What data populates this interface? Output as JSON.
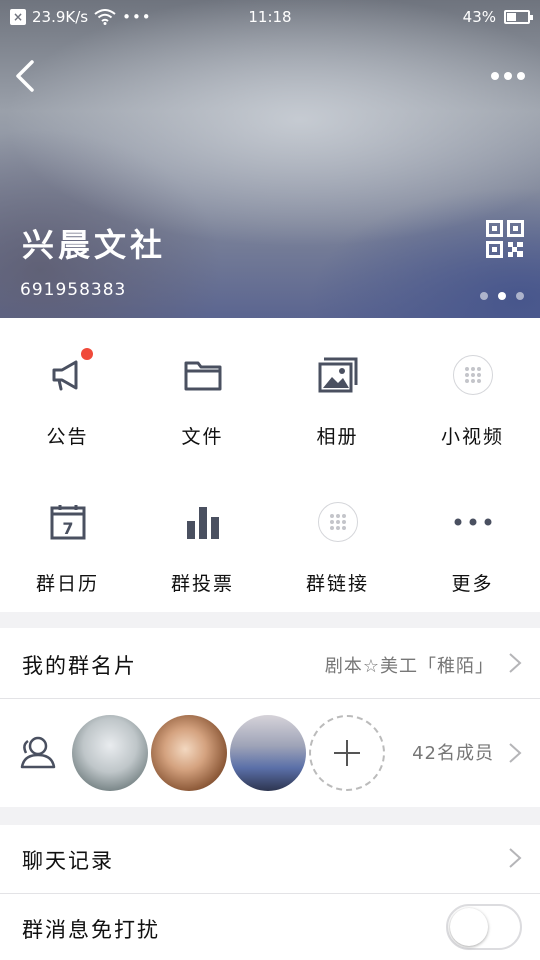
{
  "status_bar": {
    "net_speed": "23.9K/s",
    "time": "11:18",
    "battery": "43%",
    "battery_level": 0.43
  },
  "header": {
    "group_name": "兴晨文社",
    "group_id": "691958383",
    "page_count": 3,
    "active_page": 1
  },
  "grid": {
    "items": [
      {
        "label": "公告",
        "icon": "megaphone-icon"
      },
      {
        "label": "文件",
        "icon": "folder-icon"
      },
      {
        "label": "相册",
        "icon": "album-icon"
      },
      {
        "label": "小视频",
        "icon": "app-grid-icon"
      },
      {
        "label": "群日历",
        "icon": "calendar-icon"
      },
      {
        "label": "群投票",
        "icon": "bar-chart-icon"
      },
      {
        "label": "群链接",
        "icon": "app-grid-icon"
      },
      {
        "label": "更多",
        "icon": "more-icon"
      }
    ],
    "calendar_day": "7"
  },
  "group_card": {
    "label": "我的群名片",
    "value": "剧本☆美工「稚陌」"
  },
  "members": {
    "count_label": "42名成员"
  },
  "chat_history": {
    "label": "聊天记录"
  },
  "mute": {
    "label": "群消息免打扰",
    "enabled": false
  },
  "colors": {
    "accent_red": "#f04a3a",
    "icon_gray": "#4a5060"
  }
}
